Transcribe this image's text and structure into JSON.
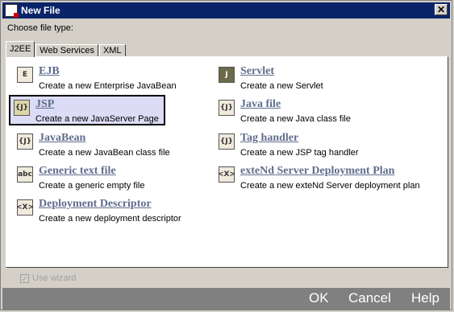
{
  "window": {
    "title": "New File",
    "close_glyph": "✕"
  },
  "choose_label": "Choose file type:",
  "tabs": [
    {
      "label": "J2EE"
    },
    {
      "label": "Web Services"
    },
    {
      "label": "XML"
    }
  ],
  "items": [
    {
      "name": "EJB",
      "desc": "Create a new Enterprise JavaBean",
      "icon": "ejb-icon",
      "glyph": "E"
    },
    {
      "name": "JSP",
      "desc": "Create a new JavaServer Page",
      "icon": "jsp-icon",
      "glyph": "{J}",
      "selected": true
    },
    {
      "name": "JavaBean",
      "desc": "Create a new JavaBean class file",
      "icon": "javabean-icon",
      "glyph": "{J}"
    },
    {
      "name": "Generic text file",
      "desc": "Create a generic empty file",
      "icon": "text-file-icon",
      "glyph": "abc"
    },
    {
      "name": "Deployment Descriptor",
      "desc": "Create a new deployment descriptor",
      "icon": "xml-icon",
      "glyph": "<X>"
    },
    {
      "name": "Servlet",
      "desc": "Create a new Servlet",
      "icon": "servlet-icon",
      "glyph": "J"
    },
    {
      "name": "Java file",
      "desc": "Create a new Java class file",
      "icon": "java-file-icon",
      "glyph": "{J}"
    },
    {
      "name": "Tag handler",
      "desc": "Create a new JSP tag handler",
      "icon": "tag-handler-icon",
      "glyph": "{J}"
    },
    {
      "name": "exteNd Server Deployment Plan",
      "desc": "Create a new exteNd Server deployment plan",
      "icon": "xml-icon",
      "glyph": "<X>"
    }
  ],
  "use_wizard": {
    "label": "Use wizard",
    "checked": true
  },
  "buttons": {
    "ok": "OK",
    "cancel": "Cancel",
    "help": "Help"
  },
  "colors": {
    "titlebar": "#0a246a",
    "link": "#5f6d8c",
    "selection": "#dcdcf7",
    "button_bar": "#808080"
  }
}
